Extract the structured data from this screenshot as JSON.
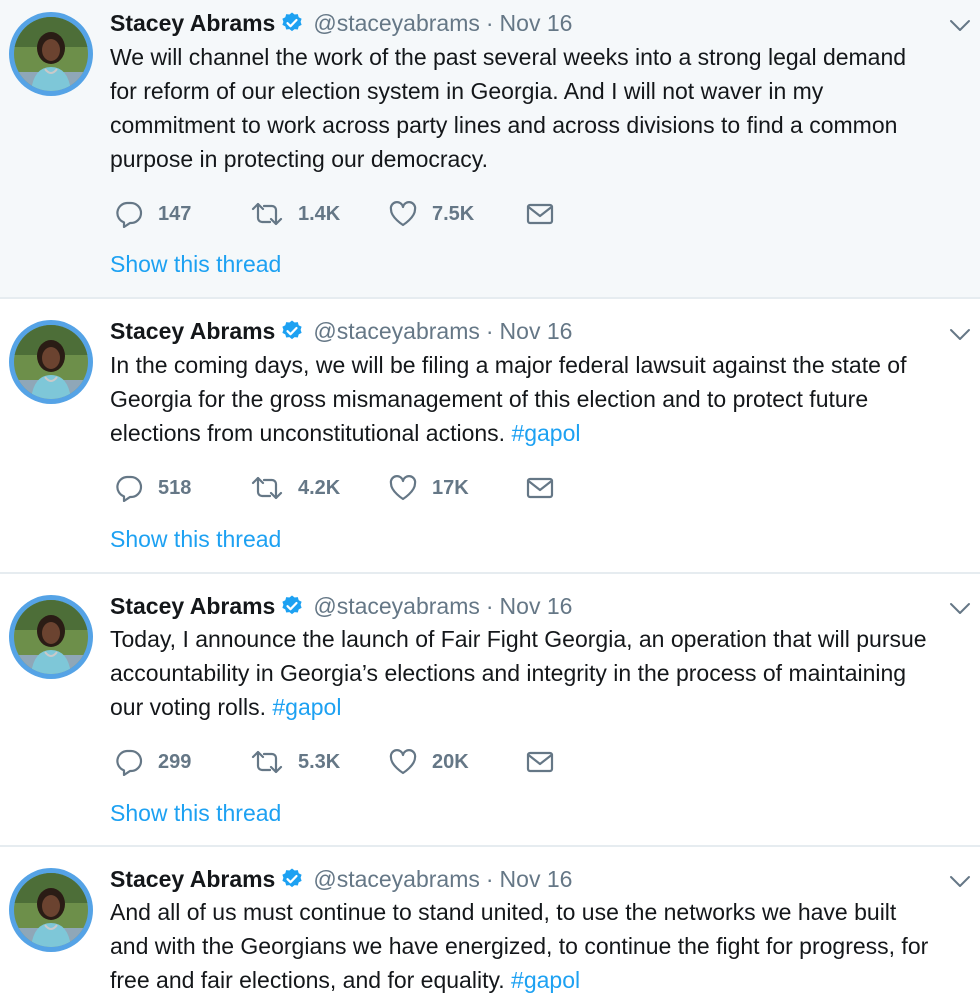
{
  "tweets": [
    {
      "author_name": "Stacey Abrams",
      "handle": "@staceyabrams",
      "separator": "·",
      "date": "Nov 16",
      "lines": [
        "We will channel the work of the past several weeks into a strong legal demand",
        "for reform of our election system in Georgia. And I will not waver in my",
        "commitment to work across party lines and across divisions to find a common",
        "purpose in protecting our democracy."
      ],
      "hashtag": "",
      "replies": "147",
      "retweets": "1.4K",
      "likes": "7.5K",
      "show_thread": "Show this thread"
    },
    {
      "author_name": "Stacey Abrams",
      "handle": "@staceyabrams",
      "separator": "·",
      "date": "Nov 16",
      "lines": [
        "In the coming days, we will be filing a major federal lawsuit against the state of",
        "Georgia for the gross mismanagement of this election and to protect future",
        "elections from unconstitutional actions. "
      ],
      "hashtag": "#gapol",
      "replies": "518",
      "retweets": "4.2K",
      "likes": "17K",
      "show_thread": "Show this thread"
    },
    {
      "author_name": "Stacey Abrams",
      "handle": "@staceyabrams",
      "separator": "·",
      "date": "Nov 16",
      "lines": [
        "Today, I announce the launch of Fair Fight Georgia, an operation that will pursue",
        "accountability in Georgia’s elections and integrity in the process of maintaining",
        "our voting rolls. "
      ],
      "hashtag": "#gapol",
      "replies": "299",
      "retweets": "5.3K",
      "likes": "20K",
      "show_thread": "Show this thread"
    },
    {
      "author_name": "Stacey Abrams",
      "handle": "@staceyabrams",
      "separator": "·",
      "date": "Nov 16",
      "lines": [
        "And all of us must continue to stand united, to use the networks we have built",
        "and with the Georgians we have energized, to continue the fight for progress, for",
        "free and fair elections, and for equality. "
      ],
      "hashtag": "#gapol"
    }
  ],
  "colors": {
    "link": "#1da1f2",
    "secondary_text": "#657786",
    "highlight_bg": "#f5f8fa",
    "avatar_ring": "#55a3e6"
  },
  "icons": {
    "verified": "verified-badge-icon",
    "caret": "chevron-down-icon",
    "reply": "reply-icon",
    "retweet": "retweet-icon",
    "like": "heart-icon",
    "message": "envelope-icon"
  }
}
